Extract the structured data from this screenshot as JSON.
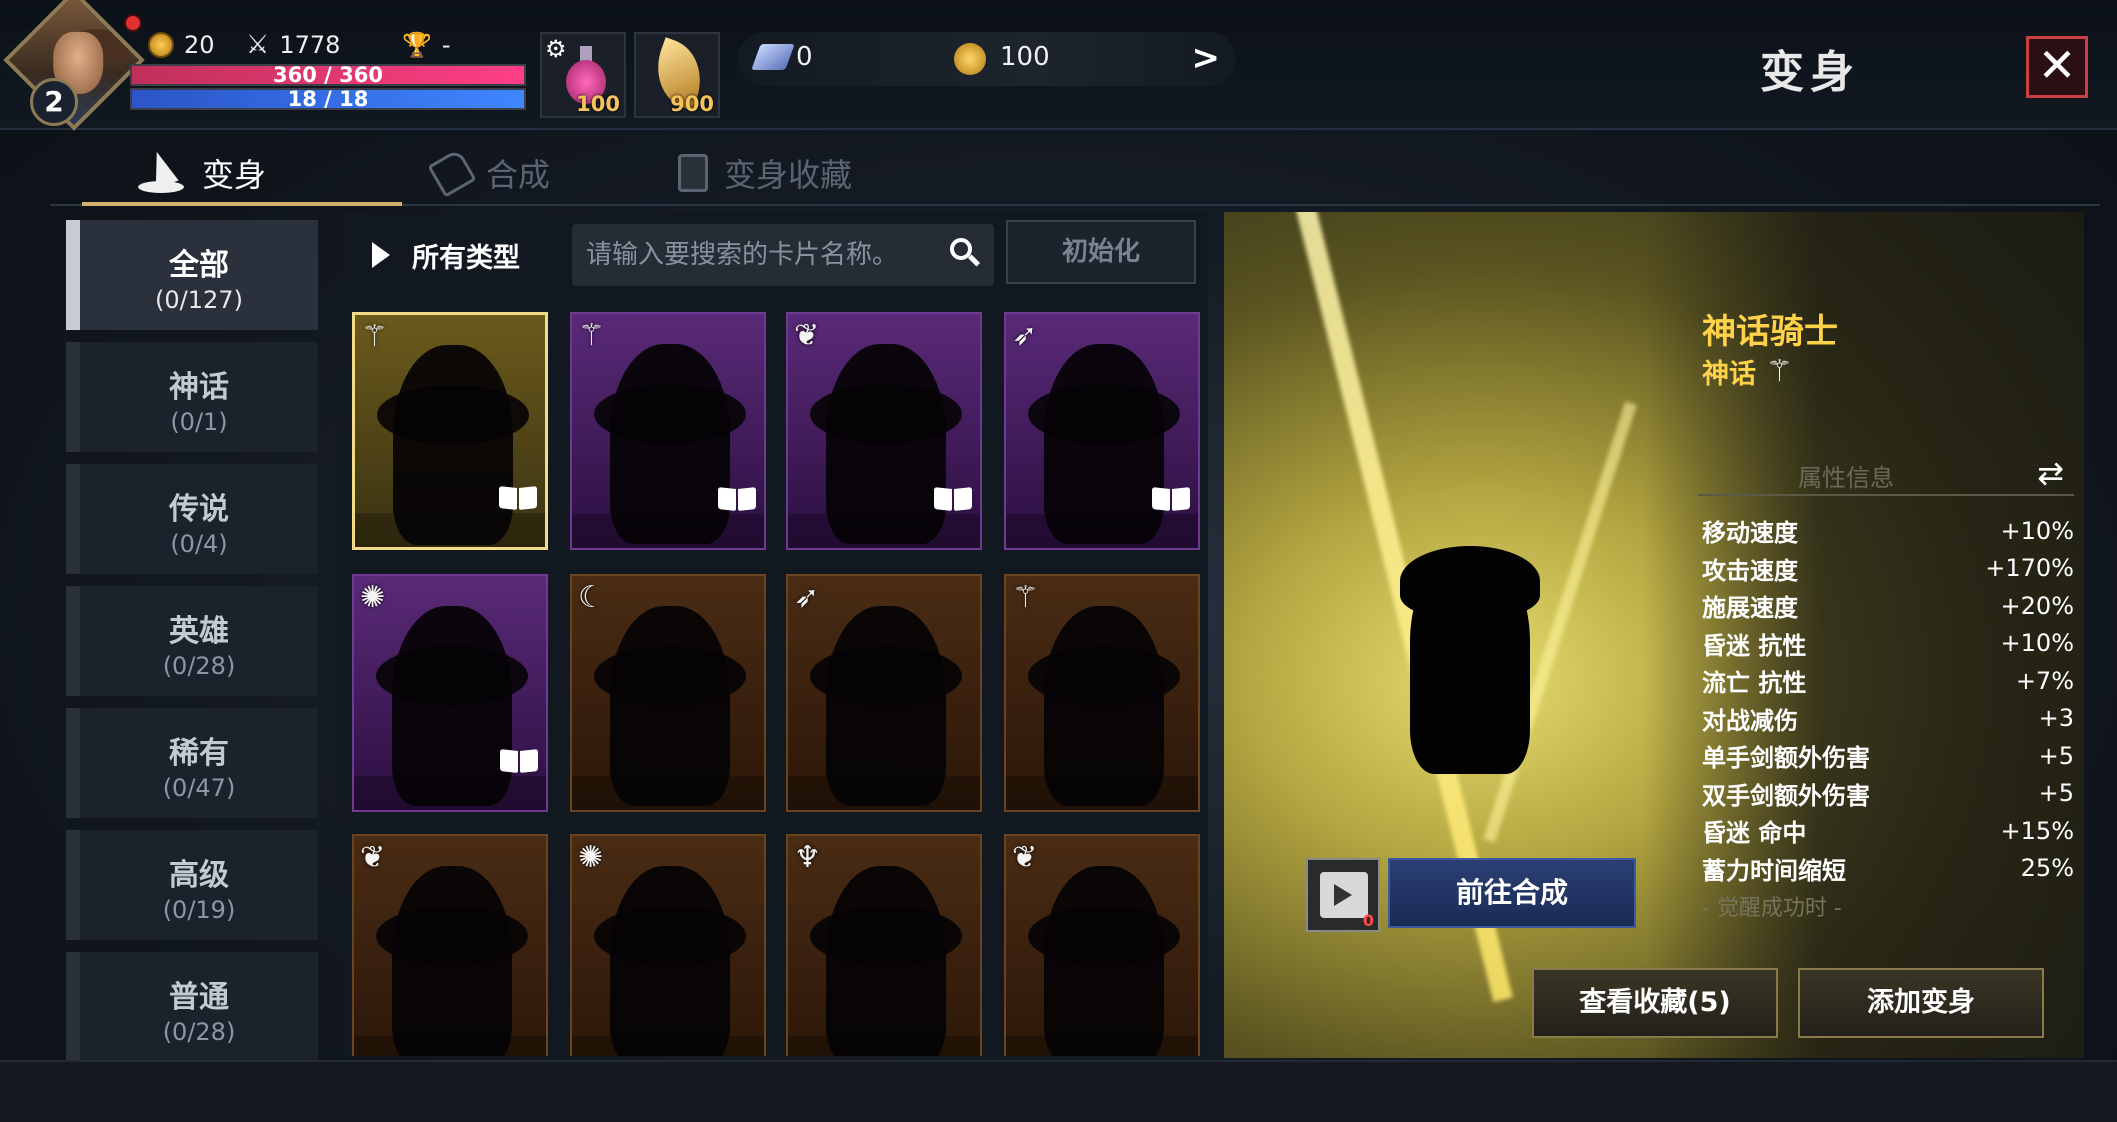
{
  "player": {
    "level": "2",
    "coins": "20",
    "combat_power": "1778",
    "rank": "-",
    "hp_text": "360 / 360",
    "hp_fraction": 1.0,
    "mp_text": "18 / 18",
    "mp_fraction": 1.0
  },
  "items": {
    "potion_count": "100",
    "leaf_count": "900"
  },
  "currency": {
    "crystal": "0",
    "gold": "100"
  },
  "header": {
    "title": "变身",
    "close_label": "✕"
  },
  "tabs": [
    {
      "label": "变身",
      "active": true
    },
    {
      "label": "合成",
      "active": false
    },
    {
      "label": "变身收藏",
      "active": false
    }
  ],
  "categories": [
    {
      "name": "全部",
      "count": "(0/127)",
      "active": true
    },
    {
      "name": "神话",
      "count": "(0/1)",
      "active": false
    },
    {
      "name": "传说",
      "count": "(0/4)",
      "active": false
    },
    {
      "name": "英雄",
      "count": "(0/28)",
      "active": false
    },
    {
      "name": "稀有",
      "count": "(0/47)",
      "active": false
    },
    {
      "name": "高级",
      "count": "(0/19)",
      "active": false
    },
    {
      "name": "普通",
      "count": "(0/28)",
      "active": false
    }
  ],
  "filter": {
    "type_label": "所有类型",
    "search_placeholder": "请输入要搜索的卡片名称。",
    "reset_label": "初始化"
  },
  "cards": [
    {
      "grade": "gold",
      "type_icon": "⚚",
      "has_book": true
    },
    {
      "grade": "purple",
      "type_icon": "⚚",
      "has_book": true
    },
    {
      "grade": "purple",
      "type_icon": "❦",
      "has_book": true
    },
    {
      "grade": "purple",
      "type_icon": "➶",
      "has_book": true
    },
    {
      "grade": "purple",
      "type_icon": "✺",
      "has_book": true
    },
    {
      "grade": "bronze",
      "type_icon": "☾",
      "has_book": false
    },
    {
      "grade": "bronze",
      "type_icon": "➶",
      "has_book": false
    },
    {
      "grade": "bronze",
      "type_icon": "⚚",
      "has_book": false
    },
    {
      "grade": "bronze",
      "type_icon": "❦",
      "has_book": false
    },
    {
      "grade": "bronze",
      "type_icon": "✺",
      "has_book": false
    },
    {
      "grade": "bronze",
      "type_icon": "♆",
      "has_book": false
    },
    {
      "grade": "bronze",
      "type_icon": "❦",
      "has_book": false
    }
  ],
  "detail": {
    "name": "神话骑士",
    "grade": "神话",
    "grade_icon": "⚚",
    "props_title": "属性信息",
    "swap_icon": "⇄",
    "props": [
      {
        "k": "移动速度",
        "v": "+10%"
      },
      {
        "k": "攻击速度",
        "v": "+170%"
      },
      {
        "k": "施展速度",
        "v": "+20%"
      },
      {
        "k": "昏迷 抗性",
        "v": "+10%"
      },
      {
        "k": "流亡 抗性",
        "v": "+7%"
      },
      {
        "k": "对战减伤",
        "v": "+3"
      },
      {
        "k": "单手剑额外伤害",
        "v": "+5"
      },
      {
        "k": "双手剑额外伤害",
        "v": "+5"
      },
      {
        "k": "昏迷 命中",
        "v": "+15%"
      },
      {
        "k": "蓄力时间缩短",
        "v": "25%"
      }
    ],
    "awaken_text": "- 觉醒成功时 -",
    "scroll_count": "0",
    "goto_label": "前往合成",
    "view_collection_label": "查看收藏(5)",
    "add_transform_label": "添加变身"
  }
}
